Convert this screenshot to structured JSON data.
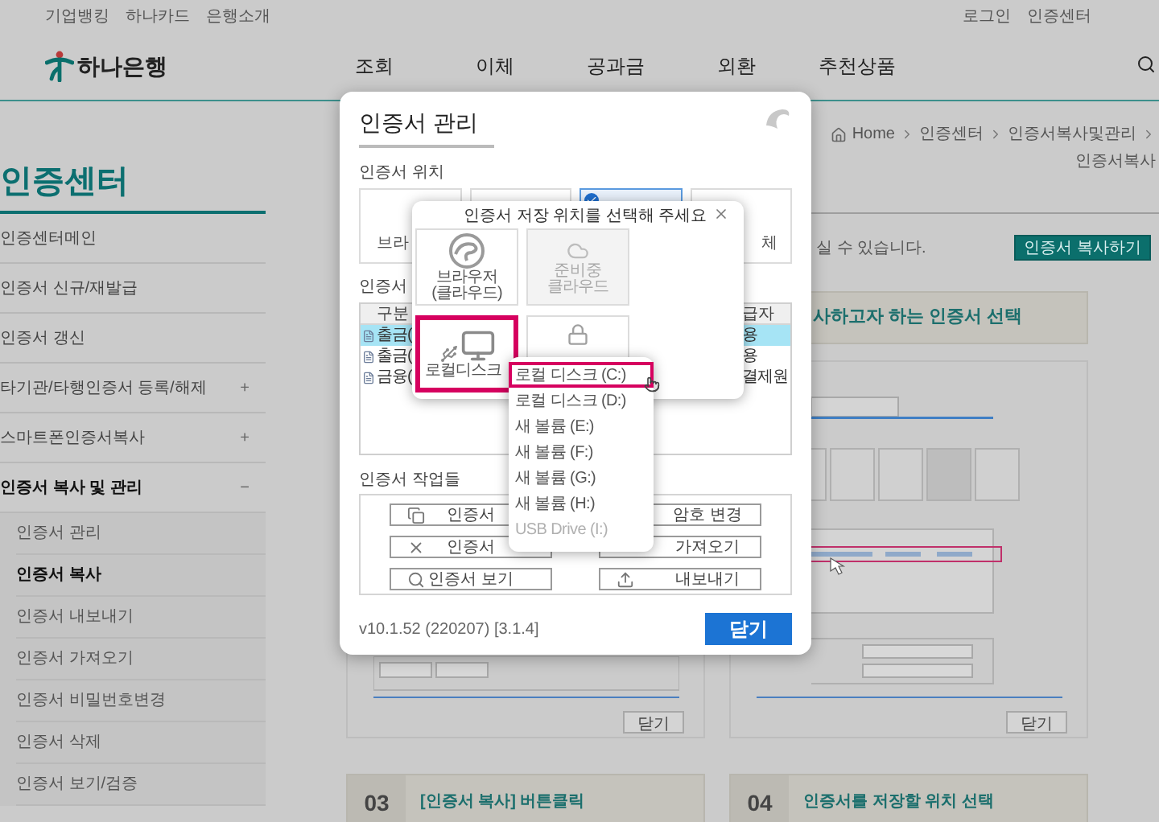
{
  "utility_links": [
    "기업뱅킹",
    "하나카드",
    "은행소개"
  ],
  "account_links": [
    "로그인",
    "인증센터"
  ],
  "logo": {
    "text": "하나은행"
  },
  "nav": [
    "조회",
    "이체",
    "공과금",
    "외환",
    "추천상품"
  ],
  "sidebar": {
    "title": "인증센터",
    "items": [
      {
        "label": "인증센터메인",
        "selected": false
      },
      {
        "label": "인증서 신규/재발급",
        "selected": false
      },
      {
        "label": "인증서 갱신",
        "selected": false
      },
      {
        "label": "타기관/타행인증서 등록/해제",
        "selected": false,
        "marker": "+"
      },
      {
        "label": "스마트폰인증서복사",
        "selected": false,
        "marker": "+"
      },
      {
        "label": "인증서 복사 및 관리",
        "selected": true,
        "marker": "−",
        "children": [
          {
            "label": "인증서 관리",
            "selected": false
          },
          {
            "label": "인증서 복사",
            "selected": true
          },
          {
            "label": "인증서 내보내기",
            "selected": false
          },
          {
            "label": "인증서 가져오기",
            "selected": false
          },
          {
            "label": "인증서 비밀번호변경",
            "selected": false
          },
          {
            "label": "인증서 삭제",
            "selected": false
          },
          {
            "label": "인증서 보기/검증",
            "selected": false
          }
        ]
      }
    ]
  },
  "breadcrumb": [
    "Home",
    "인증센터",
    "인증서복사및관리",
    "인증서복사"
  ],
  "intro_text": "실 수 있습니다.",
  "copy_button": "인증서 복사하기",
  "cards": [
    {
      "close_button": "닫기"
    },
    {
      "title": "사하고자 하는 인증서 선택",
      "close_button": "닫기"
    }
  ],
  "steps": [
    {
      "number": "03",
      "title": "[인증서 복사] 버튼클릭"
    },
    {
      "number": "04",
      "title": "인증서를 저장할 위치 선택"
    }
  ],
  "modal": {
    "title": "인증서 관리",
    "location_label": "인증서 위치",
    "locations": [
      {
        "label": "브라",
        "selected": false
      },
      {
        "selected": false
      },
      {
        "selected": true
      },
      {
        "label": "체",
        "selected": false
      }
    ],
    "list_label": "인증서",
    "table": {
      "columns": [
        "구분",
        "급자"
      ],
      "rows": [
        {
          "cells": [
            "출금(",
            "용"
          ],
          "selected": true
        },
        {
          "cells": [
            "출금(",
            "용"
          ],
          "selected": false
        },
        {
          "cells": [
            "금융(",
            "결제원"
          ],
          "selected": false
        }
      ]
    },
    "tasks_label": "인증서 작업들",
    "task_buttons": [
      {
        "kind": "copy",
        "label": "인증서"
      },
      {
        "kind": "plain",
        "label": "암호 변경"
      },
      {
        "kind": "delete",
        "label": "인증서"
      },
      {
        "kind": "plain",
        "label": "가져오기"
      },
      {
        "kind": "view",
        "label": "인증서 보기"
      },
      {
        "kind": "export",
        "label": "내보내기"
      }
    ],
    "version": "v10.1.52 (220207) [3.1.4]",
    "close_button": "닫기"
  },
  "save_popup": {
    "title": "인증서 저장 위치를 선택해 주세요",
    "options": [
      {
        "kind": "browser",
        "lines": [
          "브라우저",
          "(클라우드)"
        ],
        "selected": false,
        "disabled": false
      },
      {
        "kind": "cloud",
        "badge": "준비중",
        "lines": [
          "클라우드"
        ],
        "selected": false,
        "disabled": true
      },
      {
        "kind": "local",
        "lines": [
          "로컬디스크"
        ],
        "selected": true,
        "disabled": false
      },
      {
        "kind": "usb",
        "selected": false,
        "disabled": false
      }
    ]
  },
  "drive_menu": [
    {
      "label": "로컬 디스크 (C:)",
      "selected": true,
      "disabled": false
    },
    {
      "label": "로컬 디스크 (D:)",
      "selected": false,
      "disabled": false
    },
    {
      "label": "새 볼륨 (E:)",
      "selected": false,
      "disabled": false
    },
    {
      "label": "새 볼륨 (F:)",
      "selected": false,
      "disabled": false
    },
    {
      "label": "새 볼륨 (G:)",
      "selected": false,
      "disabled": false
    },
    {
      "label": "새 볼륨 (H:)",
      "selected": false,
      "disabled": false
    },
    {
      "label": "USB Drive (I:)",
      "selected": false,
      "disabled": true
    }
  ]
}
